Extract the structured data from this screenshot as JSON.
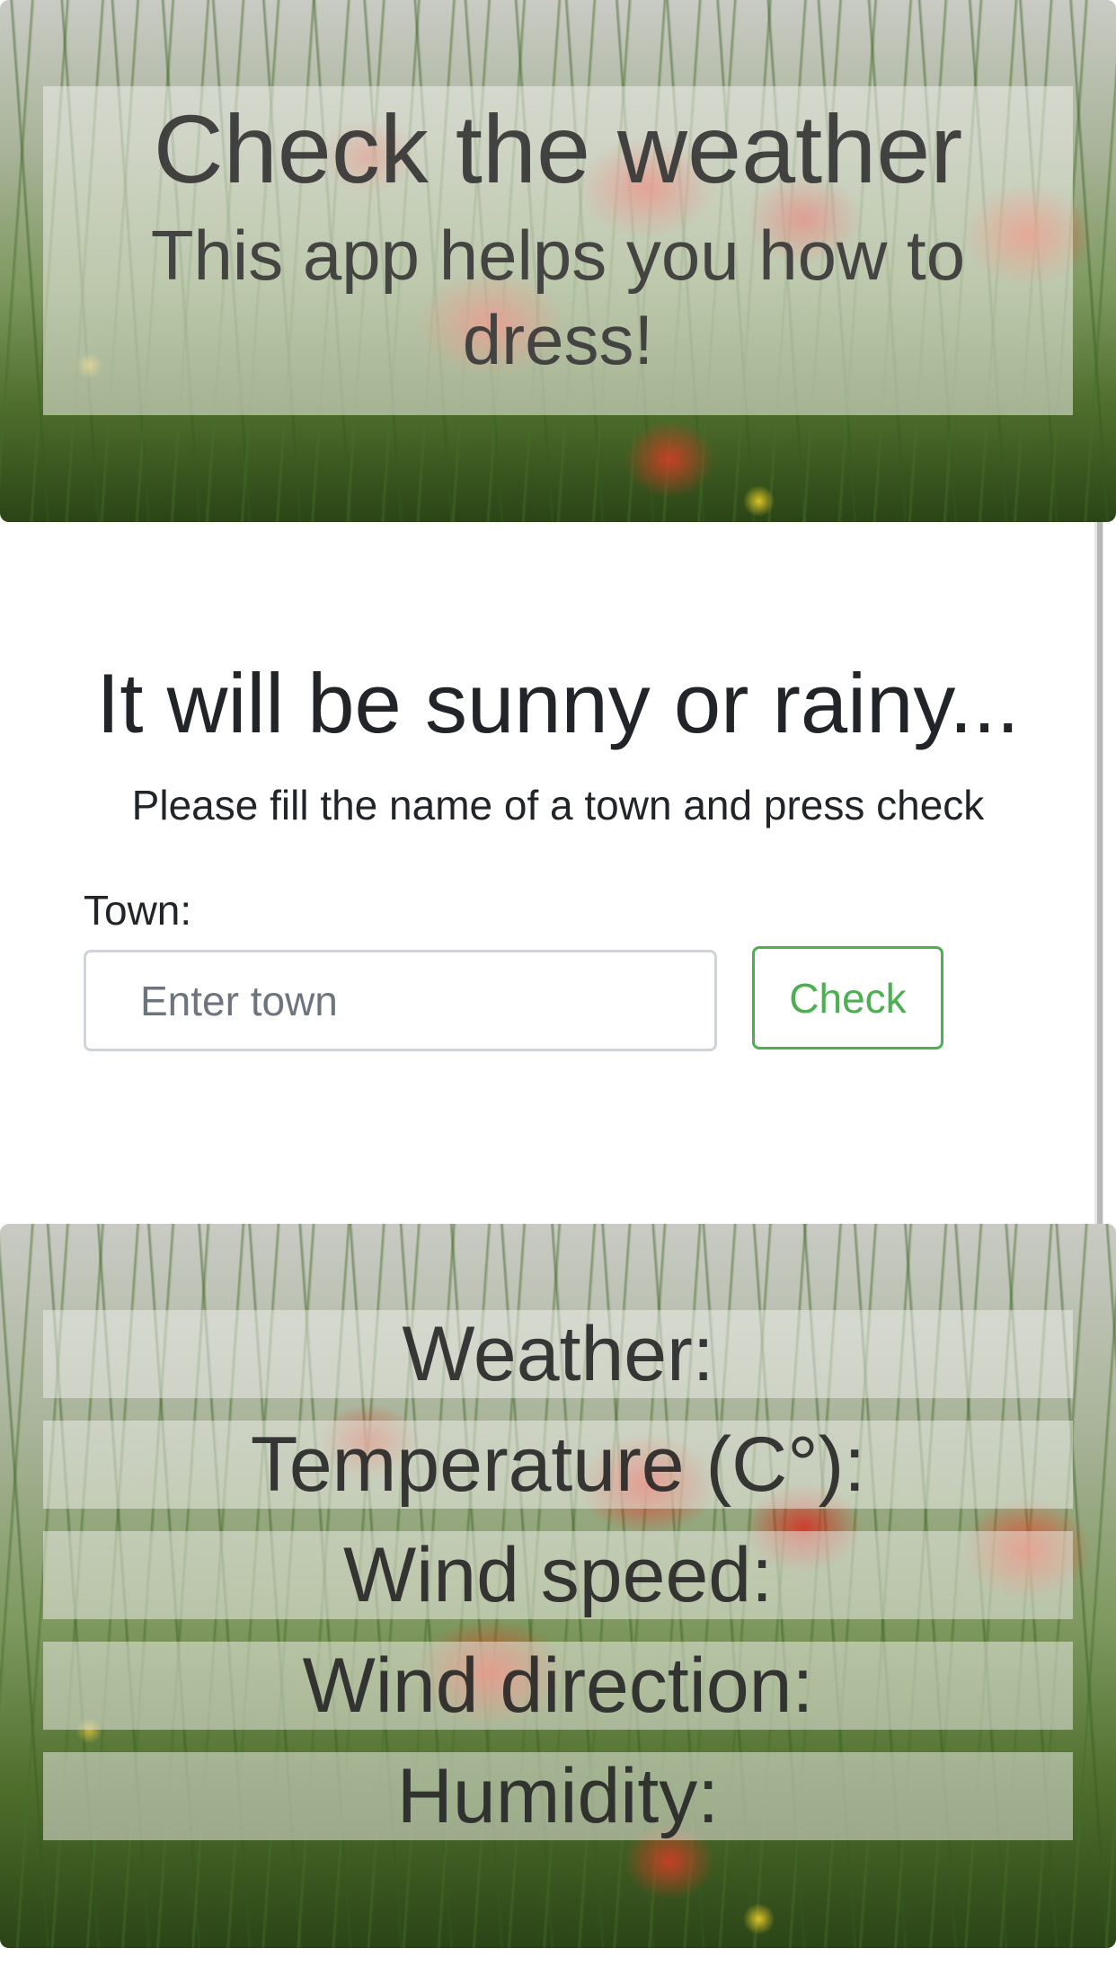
{
  "header": {
    "title": "Check the weather",
    "subtitle": "This app helps you how to dress!"
  },
  "form": {
    "heading": "It will be sunny or rainy...",
    "instructions": "Please fill the name of a town and press check",
    "town_label": "Town:",
    "town_placeholder": "Enter town",
    "town_value": "",
    "check_label": "Check"
  },
  "results": [
    {
      "label": "Weather:"
    },
    {
      "label": "Temperature (C°):"
    },
    {
      "label": "Wind speed:"
    },
    {
      "label": "Wind direction:"
    },
    {
      "label": "Humidity:"
    }
  ],
  "colors": {
    "accent_green": "#4caf50",
    "text_dark": "#212529",
    "input_border": "#ced4da"
  }
}
